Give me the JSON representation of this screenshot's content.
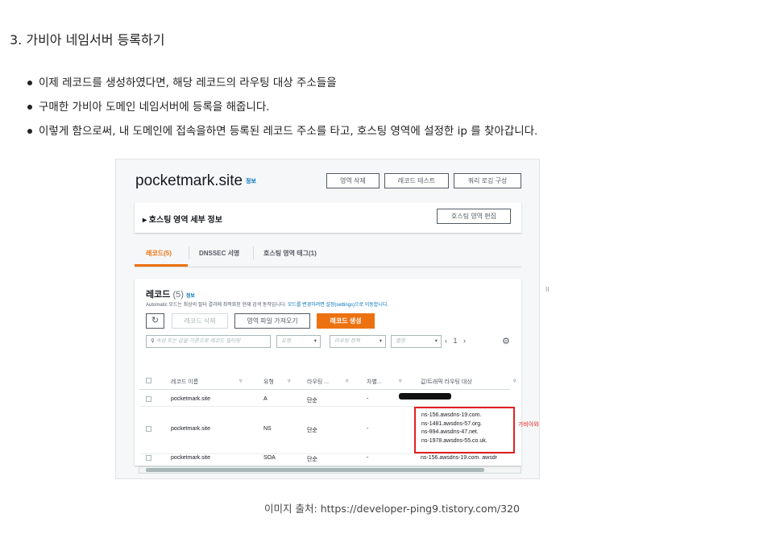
{
  "heading": "3. 가비아 네임서버 등록하기",
  "bullets": [
    "이제 레코드를 생성하였다면, 해당 레코드의 라우팅 대상 주소들을",
    "구매한 가비아 도메인 네임서버에 등록을 해줍니다.",
    "이렇게 함으로써, 내 도메인에 접속을하면 등록된 레코드 주소를 타고, 호스팅 영역에 설정한 ip 를 찾아갑니다."
  ],
  "screenshot": {
    "zone_name": "pocketmark.site",
    "info_label": "정보",
    "header_buttons": [
      "영역 삭제",
      "레코드 테스트",
      "쿼리 로깅 구성"
    ],
    "details_label": "▸ 호스팅 영역 세부 정보",
    "edit_button": "호스팅 영역 편집",
    "tabs": [
      "레코드(5)",
      "DNSSEC 서명",
      "호스팅 영역 태그(1)"
    ],
    "records": {
      "title": "레코드",
      "count": "(5)",
      "info": "정보",
      "description": "Automatic 모드는 최상의 필터 결과에 최적화된 현재 검색 동작입니다.",
      "description_link": "모드를 변경하려면 설정(settings)으로 이동합니다.",
      "refresh_icon": "refresh-icon",
      "actions": [
        "레코드 삭제",
        "영역 파일 가져오기",
        "레코드 생성"
      ],
      "search_placeholder": "속성 또는 값을 기준으로 레코드 필터링",
      "filters": [
        "유형",
        "라우팅 정책",
        "별칭"
      ],
      "page": "1",
      "columns": [
        "레코드 이름",
        "유형",
        "라우팅 ...",
        "차별...",
        "값/트래픽 라우팅 대상"
      ],
      "rows": [
        {
          "name": "pocketmark.site",
          "type": "A",
          "routing": "단순",
          "diff": "-",
          "value": ""
        },
        {
          "name": "pocketmark.site",
          "type": "NS",
          "routing": "단순",
          "diff": "-",
          "value_lines": [
            "ns-156.awsdns-19.com.",
            "ns-1481.awsdns-57.org.",
            "ns-894.awsdns-47.net.",
            "ns-1978.awsdns-55.co.uk."
          ]
        },
        {
          "name": "pocketmark.site",
          "type": "SOA",
          "routing": "단순",
          "diff": "-",
          "value": "ns-156.awsdns-19.com. awsdr"
        }
      ]
    },
    "annotation": "가비아와 연결하기 위한 주소들",
    "drag_handle": "II"
  },
  "caption": "이미지 출처: https://developer-ping9.tistory.com/320",
  "colors": {
    "accent": "#ec7211",
    "annotation": "#e02020",
    "link": "#0073bb"
  }
}
